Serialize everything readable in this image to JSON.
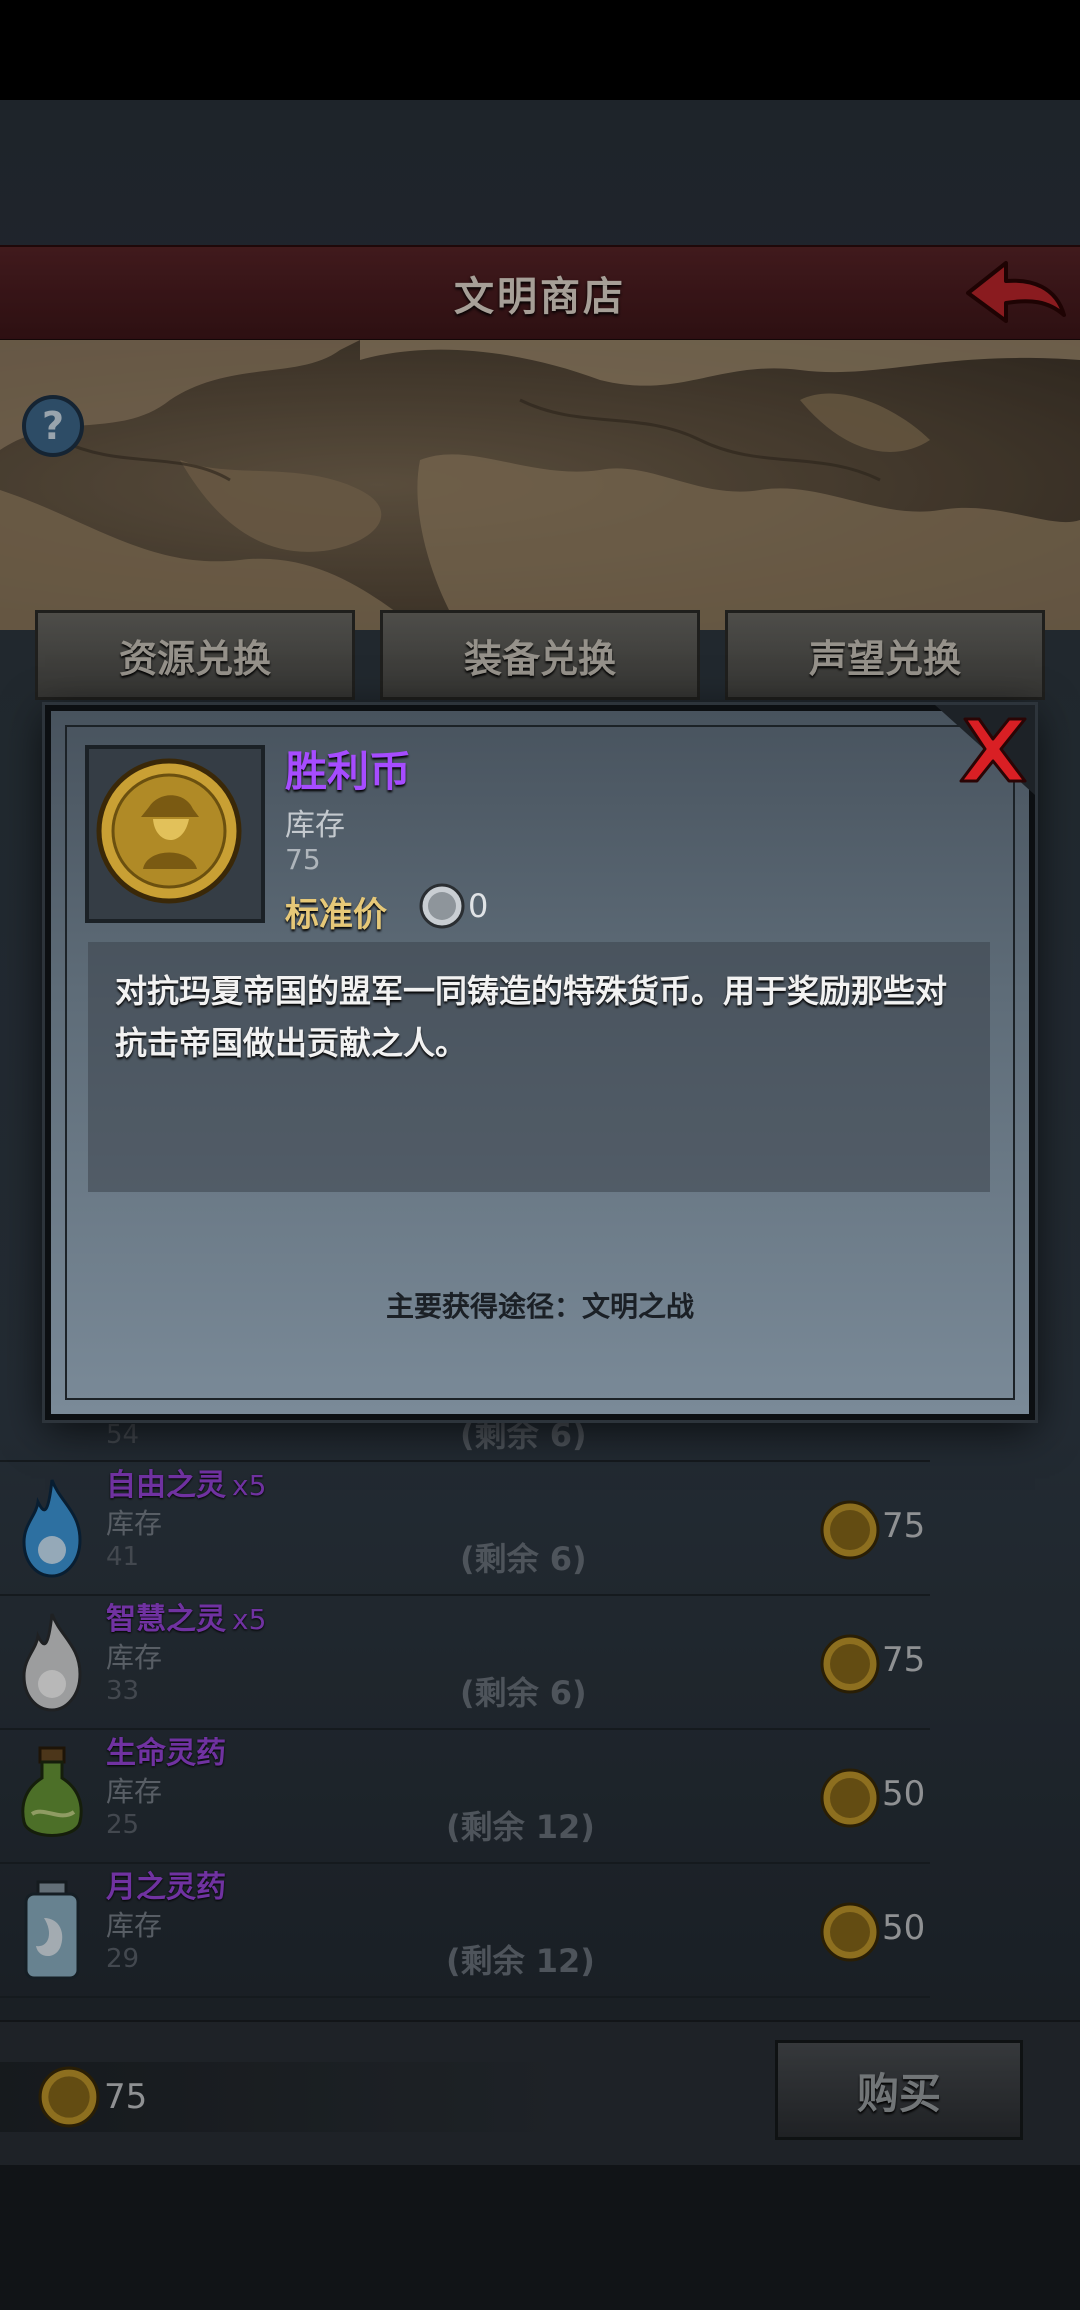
{
  "header": {
    "title": "文明商店",
    "back_icon": "back-arrow-icon"
  },
  "tabs": [
    {
      "label": "资源兑换"
    },
    {
      "label": "装备兑换"
    },
    {
      "label": "声望兑换"
    }
  ],
  "list": {
    "partial_row": {
      "stock": "54",
      "remaining": "(剩余 6)"
    },
    "rows": [
      {
        "name": "自由之灵",
        "qty": "x5",
        "stock_label": "库存",
        "stock": "41",
        "remaining": "(剩余 6)",
        "price": "75",
        "icon": "blue-flame-icon"
      },
      {
        "name": "智慧之灵",
        "qty": "x5",
        "stock_label": "库存",
        "stock": "33",
        "remaining": "(剩余 6)",
        "price": "75",
        "icon": "white-flame-icon"
      },
      {
        "name": "生命灵药",
        "qty": "",
        "stock_label": "库存",
        "stock": "25",
        "remaining": "(剩余 12)",
        "price": "50",
        "icon": "green-potion-icon"
      },
      {
        "name": "月之灵药",
        "qty": "",
        "stock_label": "库存",
        "stock": "29",
        "remaining": "(剩余 12)",
        "price": "50",
        "icon": "moon-potion-icon"
      }
    ]
  },
  "footer": {
    "balance": "75",
    "buy_label": "购买"
  },
  "modal": {
    "name": "胜利币",
    "stock_label": "库存",
    "stock": "75",
    "price_label": "标准价",
    "price": "0",
    "description": "对抗玛夏帝国的盟军一同铸造的特殊货币。用于奖励那些对抗击帝国做出贡献之人。",
    "source": "主要获得途径：文明之战",
    "close_icon": "close-x-icon"
  },
  "colors": {
    "header_red": "#5a2428",
    "item_name_purple": "#a64cff",
    "price_gold": "#e6c878"
  }
}
